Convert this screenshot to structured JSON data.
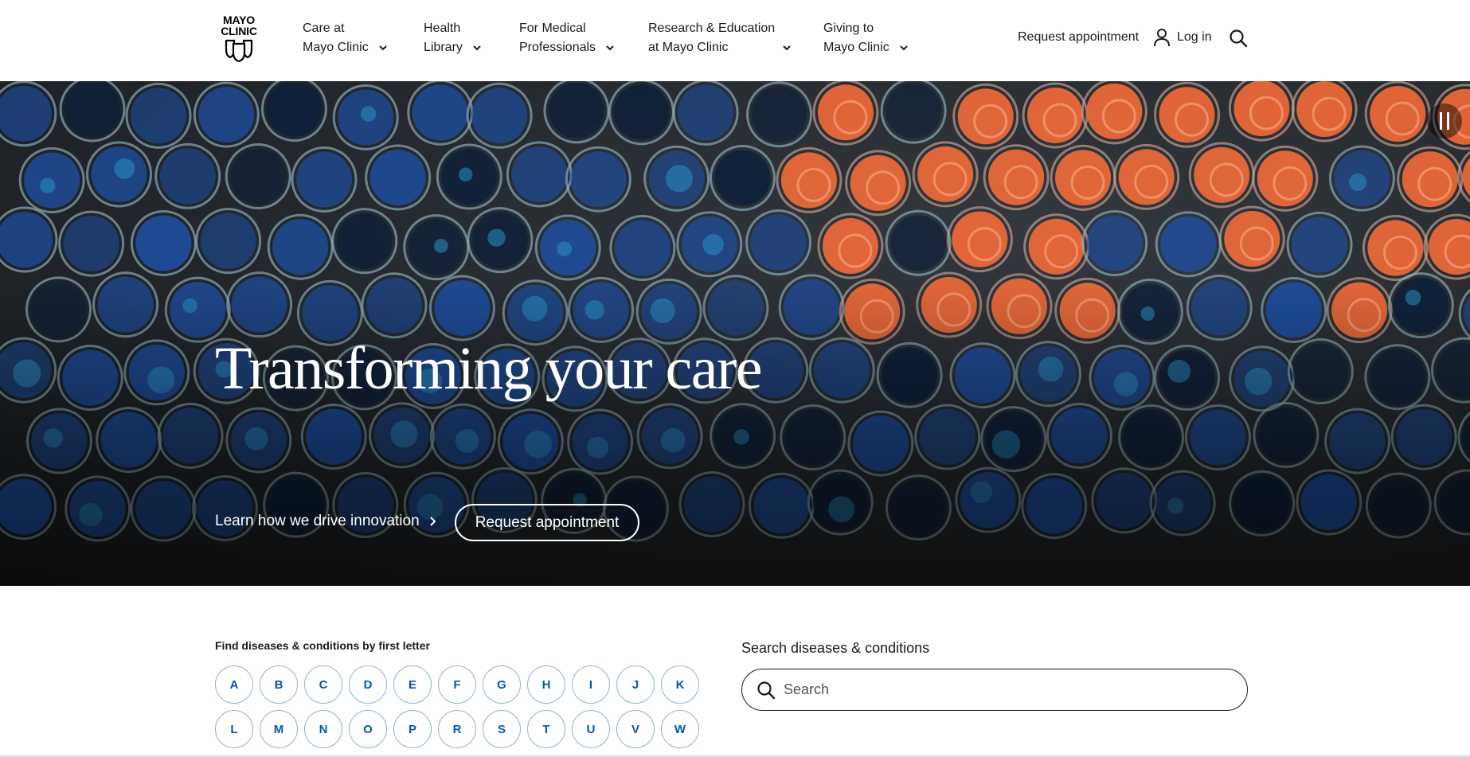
{
  "logo": {
    "line1": "MAYO",
    "line2": "CLINIC"
  },
  "nav": [
    {
      "line1": "Care at",
      "line2": "Mayo Clinic"
    },
    {
      "line1": "Health",
      "line2": "Library"
    },
    {
      "line1": "For Medical",
      "line2": "Professionals"
    },
    {
      "line1": "Research & Education",
      "line2": "at Mayo Clinic"
    },
    {
      "line1": "Giving to",
      "line2": "Mayo Clinic"
    }
  ],
  "utility": {
    "request_appointment": "Request appointment",
    "login": "Log in"
  },
  "hero": {
    "title": "Transforming your care",
    "link": "Learn how we drive innovation",
    "button": "Request appointment"
  },
  "letters_section": {
    "title": "Find diseases & conditions by first letter",
    "letters": [
      "A",
      "B",
      "C",
      "D",
      "E",
      "F",
      "G",
      "H",
      "I",
      "J",
      "K",
      "L",
      "M",
      "N",
      "O",
      "P",
      "R",
      "S",
      "T",
      "U",
      "V",
      "W"
    ]
  },
  "search_section": {
    "title": "Search diseases & conditions",
    "placeholder": "Search"
  },
  "colors": {
    "accent_blue": "#0057b8",
    "dish_blue": "#1d4fa3",
    "dish_orange": "#ef6a3a"
  }
}
